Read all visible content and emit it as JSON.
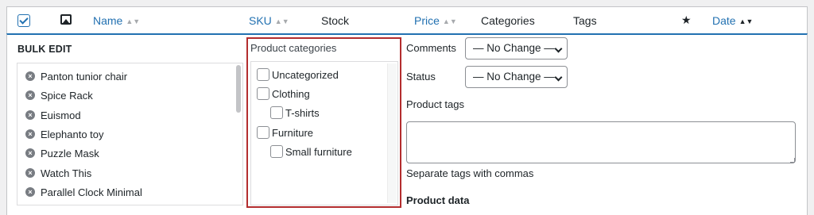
{
  "header": {
    "columns": {
      "name": "Name",
      "sku": "SKU",
      "stock": "Stock",
      "price": "Price",
      "categories": "Categories",
      "tags": "Tags",
      "date": "Date"
    },
    "sort_icon": "▲▼",
    "featured_icon": "★"
  },
  "bulk_edit": {
    "title": "BULK EDIT",
    "items": [
      "Panton tunior chair",
      "Spice Rack",
      "Euismod",
      "Elephanto toy",
      "Puzzle Mask",
      "Watch This",
      "Parallel Clock Minimal"
    ],
    "remove_icon": "×"
  },
  "categories_panel": {
    "label": "Product categories",
    "items": [
      {
        "label": "Uncategorized",
        "checked": false,
        "level": 0
      },
      {
        "label": "Clothing",
        "checked": false,
        "level": 0
      },
      {
        "label": "T-shirts",
        "checked": false,
        "level": 1
      },
      {
        "label": "Furniture",
        "checked": false,
        "level": 0
      },
      {
        "label": "Small furniture",
        "checked": false,
        "level": 1
      }
    ]
  },
  "fields": {
    "comments_label": "Comments",
    "comments_value": "— No Change —",
    "status_label": "Status",
    "status_value": "— No Change —",
    "tags_label": "Product tags",
    "tags_value": "",
    "tags_hint": "Separate tags with commas",
    "product_data_label": "Product data"
  },
  "colors": {
    "link": "#2271b1",
    "highlight_border": "#b32d2e"
  }
}
